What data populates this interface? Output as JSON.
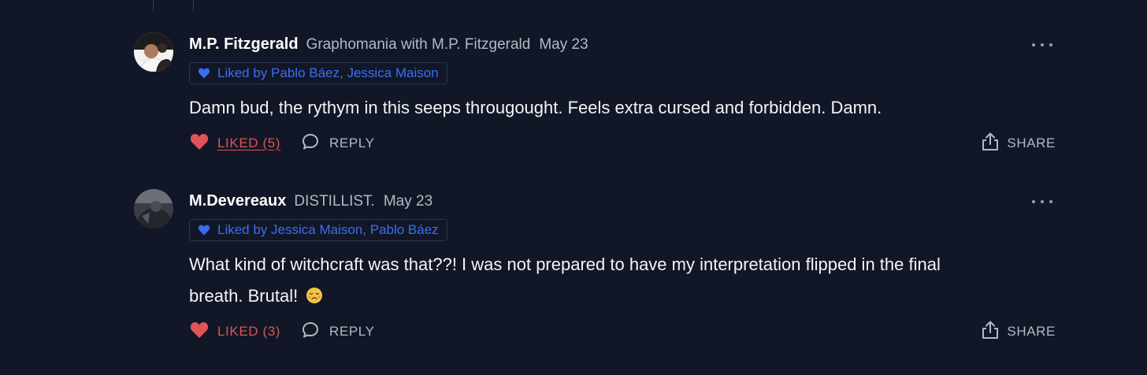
{
  "comments": [
    {
      "author": "M.P. Fitzgerald",
      "publication": "Graphomania with M.P. Fitzgerald",
      "date": "May 23",
      "liked_by": "Liked by Pablo Báez, Jessica Maison",
      "text": "Damn bud, the rythym in this seeps througought. Feels extra cursed and forbidden. Damn.",
      "like_label": "LIKED (5)",
      "reply_label": "REPLY",
      "share_label": "SHARE"
    },
    {
      "author": "M.Devereaux",
      "publication": "DISTILLIST.",
      "date": "May 23",
      "liked_by": "Liked by Jessica Maison, Pablo Báez",
      "text_line1": "What kind of witchcraft was that??! I was not prepared to have my interpretation flipped in the final",
      "text_line2": "breath. Brutal!",
      "like_label": "LIKED (3)",
      "reply_label": "REPLY",
      "share_label": "SHARE"
    }
  ],
  "colors": {
    "background": "#121727",
    "liked_red": "#e05356",
    "link_blue": "#3a6ef0",
    "muted": "#b4b8c2"
  },
  "icons": [
    "heart-icon",
    "comment-bubble-icon",
    "share-icon",
    "more-options-icon",
    "face-emoji-icon"
  ]
}
